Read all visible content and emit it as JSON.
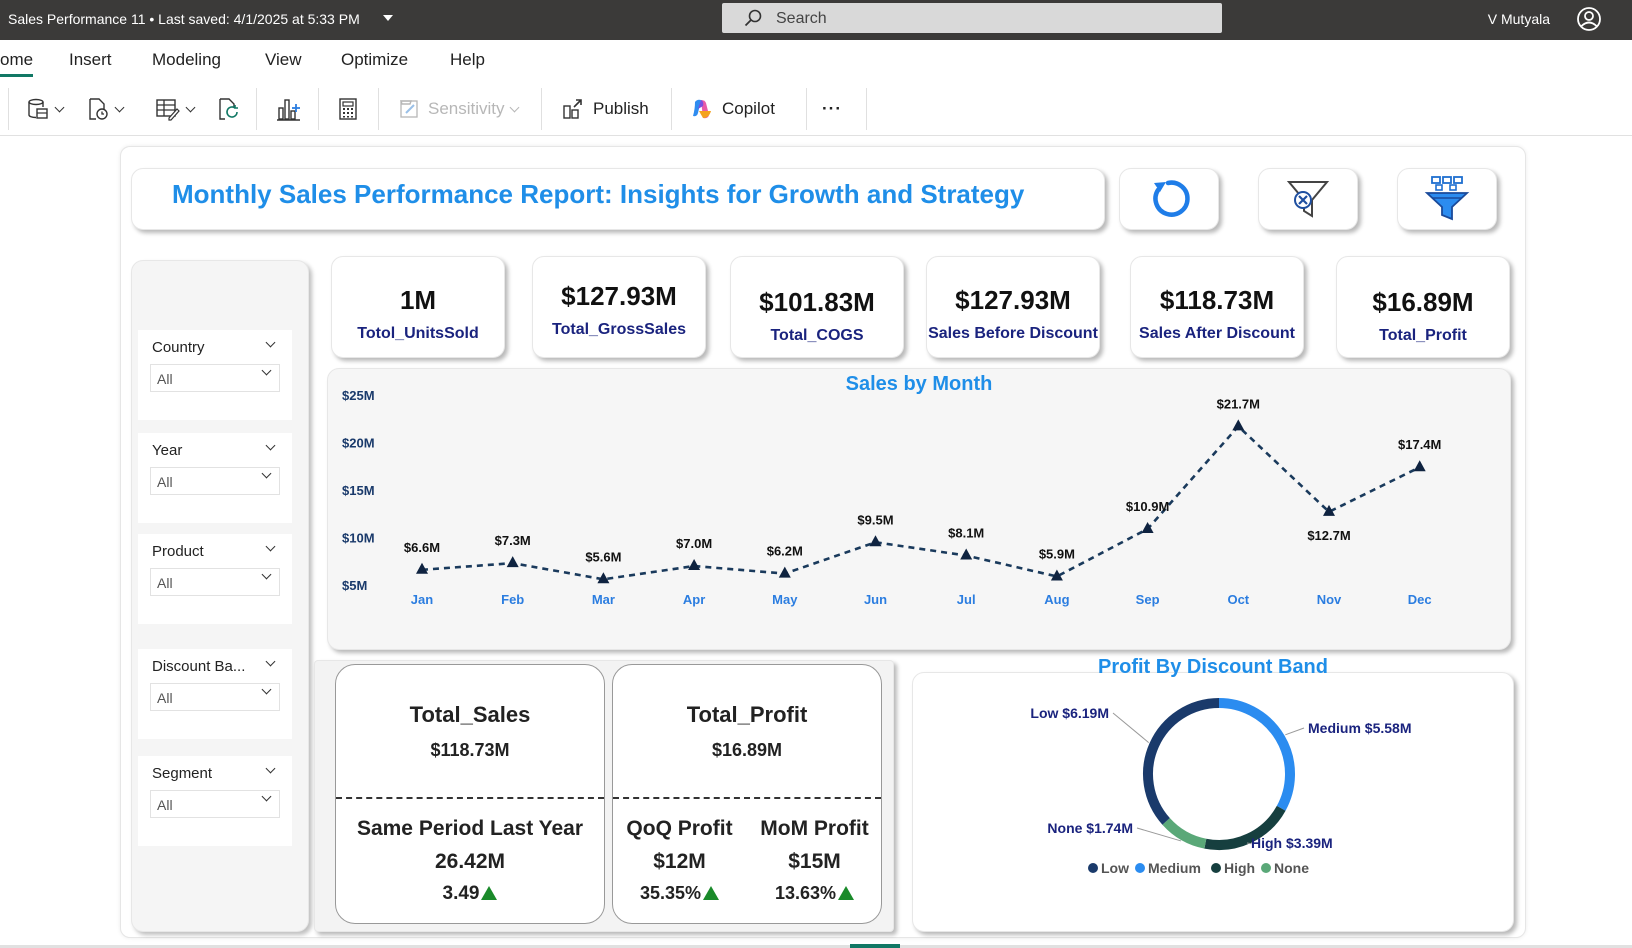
{
  "titlebar": {
    "document": "Sales Performance 11  •  Last saved: 4/1/2025 at 5:33 PM",
    "search_placeholder": "Search",
    "user": "V Mutyala"
  },
  "menu": [
    "ome",
    "Insert",
    "Modeling",
    "View",
    "Optimize",
    "Help"
  ],
  "toolbar": {
    "sensitivity": "Sensitivity",
    "publish": "Publish",
    "copilot": "Copilot",
    "more": "···"
  },
  "report": {
    "title": "Monthly Sales Performance Report: Insights for Growth and Strategy",
    "buttons": [
      "refresh-icon",
      "clear-filter-icon",
      "filter-funnel-icon"
    ]
  },
  "slicers": [
    {
      "label": "Country",
      "value": "All"
    },
    {
      "label": "Year",
      "value": "All"
    },
    {
      "label": "Product",
      "value": "All"
    },
    {
      "label": "Discount Ba...",
      "value": "All"
    },
    {
      "label": "Segment",
      "value": "All"
    }
  ],
  "kpis": [
    {
      "value": "1M",
      "label": "Totol_UnitsSold"
    },
    {
      "value": "$127.93M",
      "label": "Total_GrossSales"
    },
    {
      "value": "$101.83M",
      "label": "Total_COGS"
    },
    {
      "value": "$127.93M",
      "label": "Sales Before Discount"
    },
    {
      "value": "$118.73M",
      "label": "Sales After Discount"
    },
    {
      "value": "$16.89M",
      "label": "Total_Profit"
    }
  ],
  "chart_data": [
    {
      "type": "line",
      "title": "Sales by Month",
      "categories": [
        "Jan",
        "Feb",
        "Mar",
        "Apr",
        "May",
        "Jun",
        "Jul",
        "Aug",
        "Sep",
        "Oct",
        "Nov",
        "Dec"
      ],
      "values": [
        6.6,
        7.3,
        5.6,
        7.0,
        6.2,
        9.5,
        8.1,
        5.9,
        10.9,
        21.7,
        12.7,
        17.4
      ],
      "data_labels": [
        "$6.6M",
        "$7.3M",
        "$5.6M",
        "$7.0M",
        "$6.2M",
        "$9.5M",
        "$8.1M",
        "$5.9M",
        "$10.9M",
        "$21.7M",
        "$12.7M",
        "$17.4M"
      ],
      "y_ticks": [
        "$5M",
        "$10M",
        "$15M",
        "$20M",
        "$25M"
      ],
      "y_tick_values": [
        5,
        10,
        15,
        20,
        25
      ],
      "ylim": [
        5,
        25
      ],
      "line_style": "dashed",
      "line_color": "#1a3a5c",
      "grid": false
    },
    {
      "type": "pie",
      "title": "Profit By Discount Band",
      "categories": [
        "Low",
        "Medium",
        "High",
        "None"
      ],
      "values": [
        6.19,
        5.58,
        3.39,
        1.74
      ],
      "slice_labels": [
        "Low $6.19M",
        "Medium $5.58M",
        "High $3.39M",
        "None $1.74M"
      ],
      "colors": [
        "#1a3a6b",
        "#2b8cf0",
        "#163f3f",
        "#5aa878"
      ],
      "legend": "bottom"
    }
  ],
  "summary": {
    "sales": {
      "title": "Total_Sales",
      "value": "$118.73M",
      "sub_title": "Same Period Last Year",
      "sub_value": "26.42M",
      "change": "3.49"
    },
    "profit": {
      "title": "Total_Profit",
      "value": "$16.89M",
      "qoq_title": "QoQ Profit",
      "qoq_value": "$12M",
      "qoq_change": "35.35%",
      "mom_title": "MoM Profit",
      "mom_value": "$15M",
      "mom_change": "13.63%"
    }
  },
  "colors": {
    "accent_blue": "#1f8ee8",
    "navy": "#1a237e",
    "positive": "#1a8a2a",
    "titlebar": "#3b3a39",
    "active_tab": "#117865"
  }
}
